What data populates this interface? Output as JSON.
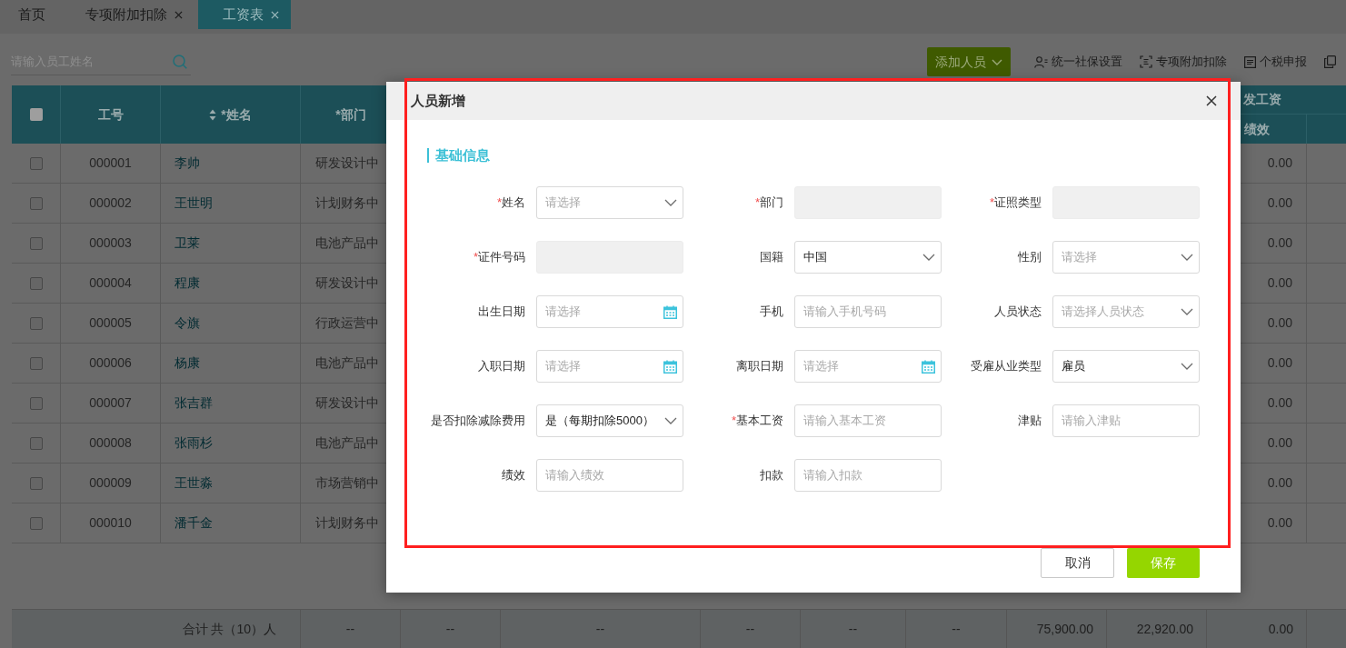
{
  "tabs": [
    {
      "label": "首页",
      "closable": false,
      "selected": false
    },
    {
      "label": "专项附加扣除",
      "closable": true,
      "selected": false
    },
    {
      "label": "工资表",
      "closable": true,
      "selected": true
    }
  ],
  "toolbar": {
    "search": {
      "placeholder": "请输入员工姓名"
    },
    "add_button": {
      "label": "添加人员"
    },
    "actions": [
      {
        "label": "统一社保设置"
      },
      {
        "label": "专项附加扣除"
      },
      {
        "label": "个税申报"
      }
    ]
  },
  "table": {
    "select_all": {
      "checked": false
    },
    "columns": [
      {
        "label": "工号",
        "sortable": false
      },
      {
        "label": "*姓名",
        "sortable": true
      },
      {
        "label": "*部门",
        "sortable": false
      }
    ],
    "group_header": "发工资",
    "subcolumn": "绩效",
    "rows": [
      {
        "checked": false,
        "id": "000001",
        "name": "李帅",
        "department": "研发设计中",
        "performance": "0.00"
      },
      {
        "checked": false,
        "id": "000002",
        "name": "王世明",
        "department": "计划财务中",
        "performance": "0.00"
      },
      {
        "checked": false,
        "id": "000003",
        "name": "卫莱",
        "department": "电池产品中",
        "performance": "0.00"
      },
      {
        "checked": false,
        "id": "000004",
        "name": "程康",
        "department": "研发设计中",
        "performance": "0.00"
      },
      {
        "checked": false,
        "id": "000005",
        "name": "令旗",
        "department": "行政运营中",
        "performance": "0.00"
      },
      {
        "checked": false,
        "id": "000006",
        "name": "杨康",
        "department": "电池产品中",
        "performance": "0.00"
      },
      {
        "checked": false,
        "id": "000007",
        "name": "张吉群",
        "department": "研发设计中",
        "performance": "0.00"
      },
      {
        "checked": false,
        "id": "000008",
        "name": "张雨杉",
        "department": "电池产品中",
        "performance": "0.00"
      },
      {
        "checked": false,
        "id": "000009",
        "name": "王世淼",
        "department": "市场营销中",
        "performance": "0.00"
      },
      {
        "checked": false,
        "id": "000010",
        "name": "潘千金",
        "department": "计划财务中",
        "performance": "0.00"
      }
    ],
    "footer": {
      "label": "合计 共（10）人",
      "cells": [
        "--",
        "--",
        "--",
        "--",
        "--",
        "--",
        "75,900.00",
        "22,920.00",
        "0.00"
      ]
    }
  },
  "dialog": {
    "title": "人员新增",
    "section": "基础信息",
    "fields": [
      {
        "label": "姓名",
        "required_mark": "*",
        "kind": "select",
        "placeholder": "请选择",
        "disabled": false
      },
      {
        "label": "部门",
        "required_mark": "*",
        "kind": "text",
        "disabled": true
      },
      {
        "label": "证照类型",
        "required_mark": "*",
        "kind": "text",
        "disabled": true
      },
      {
        "label": "证件号码",
        "required_mark": "*",
        "kind": "text",
        "disabled": true
      },
      {
        "label": "国籍",
        "kind": "select",
        "value": "中国",
        "disabled": false
      },
      {
        "label": "性别",
        "kind": "select",
        "placeholder": "请选择",
        "disabled": false
      },
      {
        "label": "出生日期",
        "kind": "date",
        "placeholder": "请选择",
        "disabled": false
      },
      {
        "label": "手机",
        "kind": "text",
        "placeholder": "请输入手机号码",
        "disabled": false
      },
      {
        "label": "人员状态",
        "kind": "select",
        "placeholder": "请选择人员状态",
        "disabled": false
      },
      {
        "label": "入职日期",
        "kind": "date",
        "placeholder": "请选择",
        "disabled": false
      },
      {
        "label": "离职日期",
        "kind": "date",
        "placeholder": "请选择",
        "disabled": false
      },
      {
        "label": "受雇从业类型",
        "kind": "select",
        "value": "雇员",
        "disabled": false
      },
      {
        "label": "是否扣除减除费用",
        "kind": "select",
        "value": "是（每期扣除5000）",
        "disabled": false
      },
      {
        "label": "基本工资",
        "required_mark": "*",
        "kind": "text",
        "placeholder": "请输入基本工资",
        "disabled": false
      },
      {
        "label": "津贴",
        "kind": "text",
        "placeholder": "请输入津贴",
        "disabled": false
      },
      {
        "label": "绩效",
        "kind": "text",
        "placeholder": "请输入绩效",
        "disabled": false
      },
      {
        "label": "扣款",
        "kind": "text",
        "placeholder": "请输入扣款",
        "disabled": false
      }
    ],
    "buttons": [
      {
        "label": "取消",
        "kind": "secondary"
      },
      {
        "label": "保存",
        "kind": "primary"
      }
    ]
  }
}
